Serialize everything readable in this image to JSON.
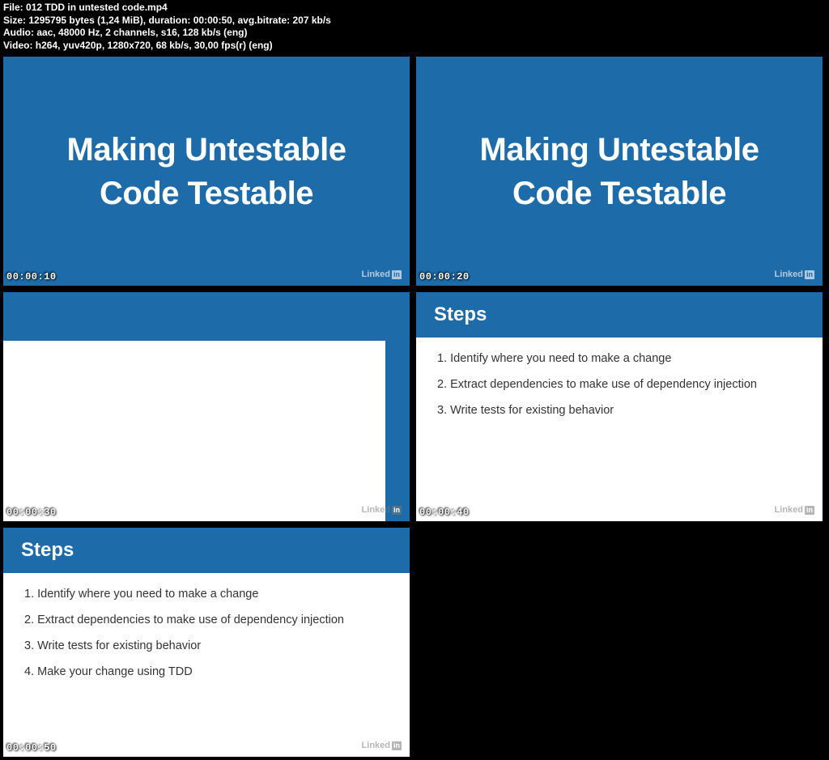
{
  "meta": {
    "file_label": "File:",
    "file_value": "012 TDD in untested code.mp4",
    "size_label": "Size:",
    "size_value": "1295795 bytes (1,24 MiB), duration: 00:00:50, avg.bitrate: 207 kb/s",
    "audio_label": "Audio:",
    "audio_value": "aac, 48000 Hz, 2 channels, s16, 128 kb/s (eng)",
    "video_label": "Video:",
    "video_value": "h264, yuv420p, 1280x720, 68 kb/s, 30,00 fps(r) (eng)"
  },
  "brand": {
    "name": "Linked",
    "suffix": "in"
  },
  "slides": {
    "title_line1": "Making Untestable",
    "title_line2": "Code Testable",
    "steps_heading": "Steps",
    "step1": "1. Identify where you need to make a change",
    "step2": "2. Extract dependencies to make use of dependency injection",
    "step3": "3. Write tests for existing behavior",
    "step4": "4. Make your change using TDD"
  },
  "timestamps": {
    "t1": "00:00:10",
    "t2": "00:00:20",
    "t3": "00:00:30",
    "t4": "00:00:40",
    "t5": "00:00:50"
  }
}
